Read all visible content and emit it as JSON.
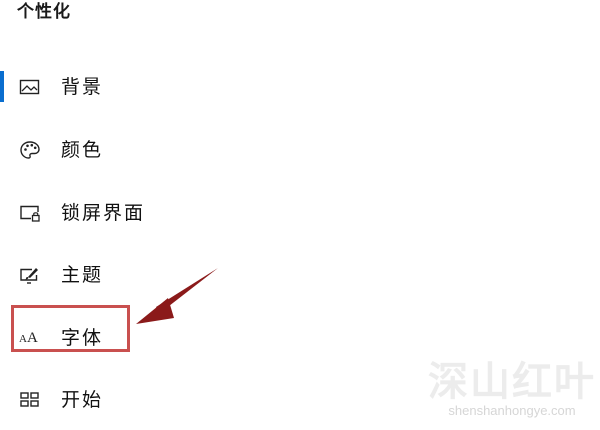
{
  "page": {
    "title": "个性化"
  },
  "nav": {
    "items": [
      {
        "label": "背景",
        "icon": "picture-icon",
        "selected": true
      },
      {
        "label": "颜色",
        "icon": "palette-icon",
        "selected": false
      },
      {
        "label": "锁屏界面",
        "icon": "lock-screen-icon",
        "selected": false
      },
      {
        "label": "主题",
        "icon": "theme-brush-icon",
        "selected": false
      },
      {
        "label": "字体",
        "icon": "font-icon",
        "selected": false
      },
      {
        "label": "开始",
        "icon": "start-grid-icon",
        "selected": false
      }
    ]
  },
  "font_icon_glyphs": {
    "small": "A",
    "large": "A"
  },
  "annotation": {
    "color": "#c9504f",
    "arrow_color": "#8b1a1a"
  },
  "watermark": {
    "main": "深山红叶",
    "sub": "shenshanhongye.com"
  },
  "colors": {
    "accent": "#0a6ecf",
    "text": "#111111"
  }
}
